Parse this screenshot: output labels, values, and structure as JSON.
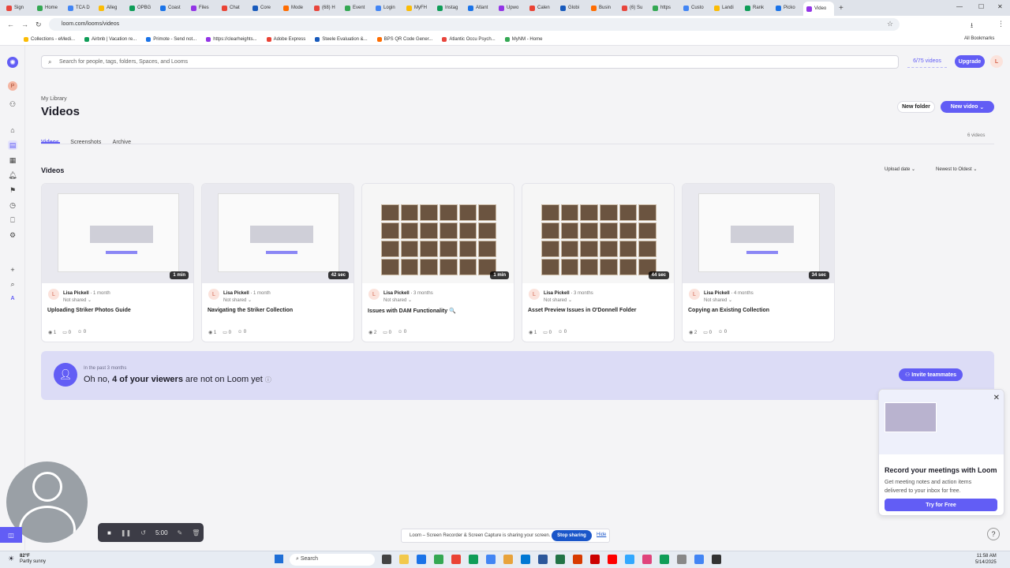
{
  "browser": {
    "tabs": [
      "Sign",
      "Home",
      "TCA D",
      "Alleg",
      "OPBG",
      "Coast",
      "Files",
      "Chat",
      "Core",
      "Mode",
      "(68) H",
      "Event",
      "Login",
      "MyFH",
      "Instag",
      "Atlant",
      "Upwo",
      "Calen",
      "Globi",
      "Busin",
      "(6) Su",
      "https",
      "Custo",
      "Landi",
      "Rank",
      "Picko",
      "Video"
    ],
    "active_tab_index": 26,
    "url": "loom.com/looms/videos",
    "bookmarks": [
      "Collections - eMedi...",
      "Airbnb | Vacation re...",
      "Primote - Send not...",
      "https://clearheights...",
      "Adobe Express",
      "Steele Evaluation &...",
      "BPS QR Code Gener...",
      "Atlantic Occu Psych...",
      "MyNM - Home"
    ],
    "all_bookmarks": "All Bookmarks"
  },
  "app": {
    "search_placeholder": "Search for people, tags, folders, Spaces, and Looms",
    "quota": "6/75 videos",
    "upgrade": "Upgrade",
    "user_initial": "L",
    "workspace_initial": "P",
    "breadcrumb": "My Library",
    "page_title": "Videos",
    "new_folder": "New folder",
    "new_video": "New video",
    "tabs": [
      "Videos",
      "Screenshots",
      "Archive"
    ],
    "active_tab": "Videos",
    "video_count": "6 videos",
    "section_title": "Videos",
    "sort_field": "Upload date",
    "sort_order": "Newest to Oldest",
    "accent": "#625df5"
  },
  "videos": [
    {
      "owner": "Lisa Pickell",
      "age": "1 month",
      "shared": "Not shared",
      "title": "Uploading Striker Photos Guide",
      "duration": "1 min",
      "views": "1",
      "comments": "0",
      "reactions": "0",
      "thumb": "ui"
    },
    {
      "owner": "Lisa Pickell",
      "age": "1 month",
      "shared": "Not shared",
      "title": "Navigating the Striker Collection",
      "duration": "42 sec",
      "views": "1",
      "comments": "0",
      "reactions": "0",
      "thumb": "ui"
    },
    {
      "owner": "Lisa Pickell",
      "age": "3 months",
      "shared": "Not shared",
      "title": "Issues with DAM Functionality 🔍",
      "duration": "1 min",
      "views": "2",
      "comments": "0",
      "reactions": "0",
      "thumb": "grid"
    },
    {
      "owner": "Lisa Pickell",
      "age": "3 months",
      "shared": "Not shared",
      "title": "Asset Preview Issues in O'Donnell Folder",
      "duration": "44 sec",
      "views": "1",
      "comments": "0",
      "reactions": "0",
      "thumb": "grid"
    },
    {
      "owner": "Lisa Pickell",
      "age": "4 months",
      "shared": "Not shared",
      "title": "Copying an Existing Collection",
      "duration": "34 sec",
      "views": "2",
      "comments": "0",
      "reactions": "0",
      "thumb": "ui"
    }
  ],
  "banner": {
    "eyebrow": "In the past 3 months",
    "pre": "Oh no, ",
    "bold": "4 of your viewers",
    "post": " are not on Loom yet",
    "cta": "Invite teammates"
  },
  "promo": {
    "title": "Record your meetings with Loom",
    "body": "Get meeting notes and action items delivered to your inbox for free.",
    "cta": "Try for Free"
  },
  "recorder": {
    "timer": "5:00",
    "share_text": "Loom – Screen Recorder & Screen Capture is sharing your screen.",
    "stop": "Stop sharing",
    "hide": "Hide"
  },
  "taskbar": {
    "weather_temp": "82°F",
    "weather_desc": "Partly sunny",
    "search": "Search",
    "time": "11:58 AM",
    "date": "5/14/2025"
  }
}
